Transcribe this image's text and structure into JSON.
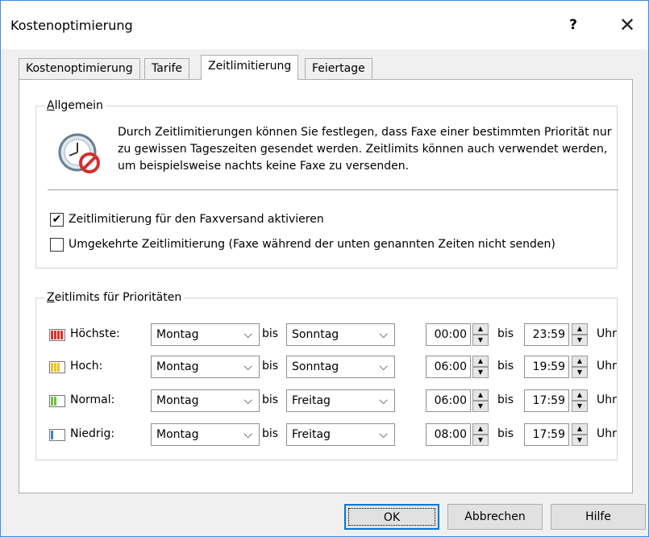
{
  "window": {
    "title": "Kostenoptimierung",
    "help_label": "?",
    "close_label": "✕"
  },
  "tabs": [
    {
      "label": "Kostenoptimierung",
      "active": false
    },
    {
      "label": "Tarife",
      "active": false
    },
    {
      "label": "Zeitlimitierung",
      "active": true
    },
    {
      "label": "Feiertage",
      "active": false
    }
  ],
  "general": {
    "title_u": "A",
    "title_rest": "llgemein",
    "info": "Durch Zeitlimitierungen können Sie festlegen, dass Faxe einer bestimmten Priorität nur zu gewissen Tageszeiten gesendet werden. Zeitlimits können auch verwendet werden, um beispielsweise nachts keine Faxe zu versenden.",
    "icon": "clock-forbidden-icon",
    "enable": {
      "label": "Zeitlimitierung für den Faxversand aktivieren",
      "checked": true
    },
    "invert": {
      "label": "Umgekehrte Zeitlimitierung (Faxe während der unten genannten Zeiten nicht senden)",
      "checked": false
    }
  },
  "limits": {
    "title_u": "Z",
    "title_rest": "eitlimits für Prioritäten",
    "bis": "bis",
    "uhr": "Uhr",
    "rows": [
      {
        "label": "Höchste:",
        "color": "#d9342b",
        "from_day": "Montag",
        "to_day": "Sonntag",
        "from_time": "00:00",
        "to_time": "23:59"
      },
      {
        "label": "Hoch:",
        "color": "#f2c318",
        "from_day": "Montag",
        "to_day": "Sonntag",
        "from_time": "06:00",
        "to_time": "19:59"
      },
      {
        "label": "Normal:",
        "color": "#6cc43a",
        "from_day": "Montag",
        "to_day": "Freitag",
        "from_time": "06:00",
        "to_time": "17:59"
      },
      {
        "label": "Niedrig:",
        "color": "#3e7fd0",
        "from_day": "Montag",
        "to_day": "Freitag",
        "from_time": "08:00",
        "to_time": "17:59"
      }
    ]
  },
  "buttons": {
    "ok": "OK",
    "cancel": "Abbrechen",
    "help": "Hilfe"
  }
}
